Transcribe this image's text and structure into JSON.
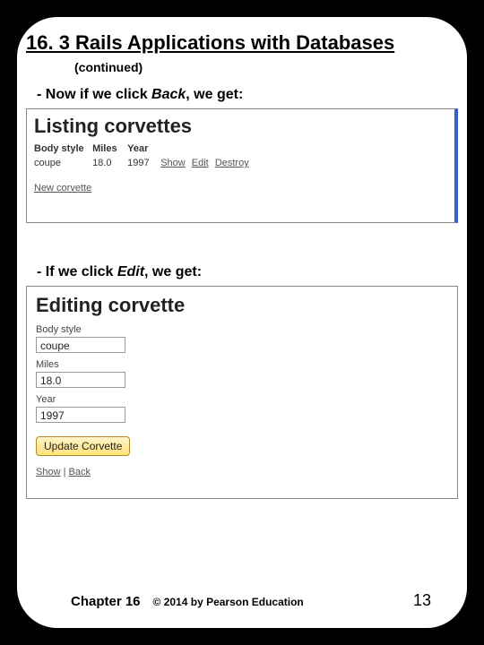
{
  "title": "16. 3 Rails Applications with Databases",
  "subtitle": "(continued)",
  "note1_prefix": "- Now if we click ",
  "note1_emph": "Back",
  "note1_suffix": ", we get:",
  "listing": {
    "heading": "Listing corvettes",
    "cols": {
      "body": "Body style",
      "miles": "Miles",
      "year": "Year"
    },
    "row": {
      "body": "coupe",
      "miles": "18.0",
      "year": "1997"
    },
    "actions": {
      "show": "Show",
      "edit": "Edit",
      "destroy": "Destroy"
    },
    "new_link": "New corvette"
  },
  "note2_prefix": "- If we click ",
  "note2_emph": "Edit",
  "note2_suffix": ", we get:",
  "edit": {
    "heading": "Editing corvette",
    "labels": {
      "body": "Body style",
      "miles": "Miles",
      "year": "Year"
    },
    "values": {
      "body": "coupe",
      "miles": "18.0",
      "year": "1997"
    },
    "button": "Update Corvette",
    "links": {
      "show": "Show",
      "sep": " | ",
      "back": "Back"
    }
  },
  "footer": {
    "chapter": "Chapter 16",
    "copyright": "© 2014 by Pearson Education",
    "page": "13"
  }
}
